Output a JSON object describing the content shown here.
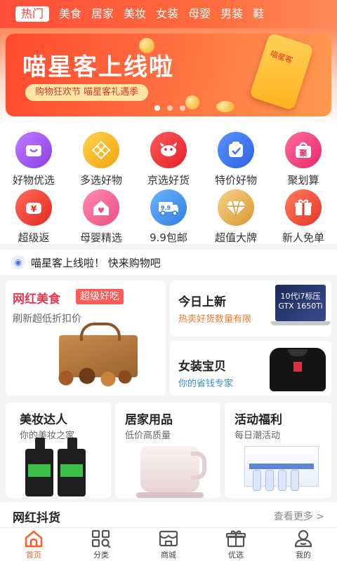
{
  "colors": {
    "brand": "#ff5b2e",
    "accent_red": "#e7374d",
    "active_nav": "#ff5b2e"
  },
  "top_tabs": {
    "items": [
      {
        "label": "热门",
        "active": true
      },
      {
        "label": "美食"
      },
      {
        "label": "居家"
      },
      {
        "label": "美妆"
      },
      {
        "label": "女装"
      },
      {
        "label": "母婴"
      },
      {
        "label": "男装"
      },
      {
        "label": "鞋"
      }
    ]
  },
  "banner": {
    "title": "喵星客上线啦",
    "subtitle": "购物狂欢节 喵星客礼遇季",
    "phone_text": "喵星客",
    "slides": 3,
    "active_slide": 1
  },
  "icon_grid": {
    "items": [
      {
        "label": "好物优选",
        "icon": "shopping-bag-icon",
        "color": "#a65cf0"
      },
      {
        "label": "多选好物",
        "icon": "grid-pattern-icon",
        "color": "#f5b81f"
      },
      {
        "label": "京选好货",
        "icon": "dog-icon",
        "color": "#f0323a"
      },
      {
        "label": "特价好物",
        "icon": "check-tag-icon",
        "color": "#3e7bf2"
      },
      {
        "label": "聚划算",
        "icon": "gather-bag-icon",
        "color": "#f2407a"
      },
      {
        "label": "超级返",
        "icon": "yuan-icon",
        "color": "#f04135"
      },
      {
        "label": "母婴精选",
        "icon": "heart-house-icon",
        "color": "#f45f8e"
      },
      {
        "label": "9.9包邮",
        "icon": "truck-icon",
        "color": "#4a9bf0",
        "glyph": "9.9"
      },
      {
        "label": "超值大牌",
        "icon": "diamond-icon",
        "color": "#e9b04a"
      },
      {
        "label": "新人免单",
        "icon": "gift-icon",
        "color": "#f4533c"
      }
    ]
  },
  "notice": {
    "text": "喵星客上线啦！ 快来购物吧"
  },
  "cards": {
    "food": {
      "title": "网红美食",
      "badge": "超级好吃",
      "subtitle": "刷新超低折扣价"
    },
    "new_today": {
      "title": "今日上新",
      "subtitle": "热卖好货数量有限",
      "laptop_text": "10代i7标压 GTX 1650Ti"
    },
    "women": {
      "title": "女装宝贝",
      "subtitle": "你的省钱专家"
    },
    "beauty": {
      "title": "美妆达人",
      "subtitle": "你的美妆之家"
    },
    "home": {
      "title": "居家用品",
      "subtitle": "低价高质量"
    },
    "welfare": {
      "title": "活动福利",
      "subtitle": "每日潮活动"
    }
  },
  "section": {
    "title": "网红抖货",
    "more": "查看更多 >"
  },
  "bottom_nav": {
    "items": [
      {
        "label": "首页",
        "icon": "home-icon",
        "active": true
      },
      {
        "label": "分类",
        "icon": "category-icon"
      },
      {
        "label": "商城",
        "icon": "store-icon"
      },
      {
        "label": "优选",
        "icon": "gift-box-icon"
      },
      {
        "label": "我的",
        "icon": "profile-icon"
      }
    ]
  }
}
